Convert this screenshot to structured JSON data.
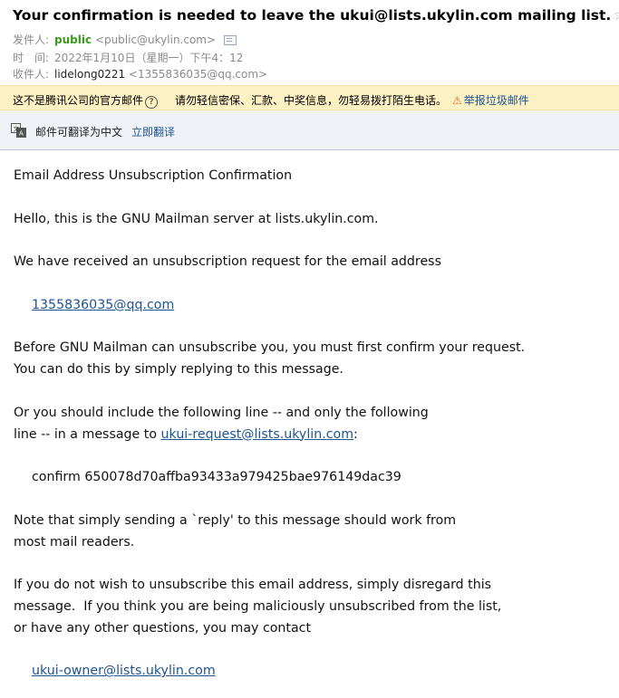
{
  "header": {
    "subject": "Your confirmation is needed to leave the ukui@lists.ukylin.com mailing list.",
    "star": "☆",
    "from_label": "发件人:",
    "from_name": "public",
    "from_address": "<public@ukylin.com>",
    "time_label": "时　间:",
    "time_value": "2022年1月10日（星期一）下午4：12",
    "to_label": "收件人:",
    "to_name": "lidelong0221",
    "to_address": "<1355836035@qq.com>"
  },
  "warning": {
    "text1": "这不是腾讯公司的官方邮件",
    "qmark": "?",
    "text2": "请勿轻信密保、汇款、中奖信息，勿轻易拨打陌生电话。",
    "report_label": "举报垃圾邮件"
  },
  "translate": {
    "text": "邮件可翻译为中文",
    "link": "立即翻译"
  },
  "body": {
    "l1": "Email Address Unsubscription Confirmation",
    "l2": "Hello, this is the GNU Mailman server at lists.ukylin.com.",
    "l3": "We have received an unsubscription request for the email address",
    "email_link": "1355836035@qq.com",
    "l5a": "Before GNU Mailman can unsubscribe you, you must first confirm your request.",
    "l5b": "You can do this by simply replying to this message.",
    "l6a": "Or you should include the following line -- and only the following",
    "l6b_prefix": "line -- in a message to ",
    "request_link": "ukui-request@lists.ukylin.com",
    "l6b_suffix": ":",
    "confirm_line": "confirm 650078d70affba93433a979425bae976149dac39",
    "l8a": "Note that simply sending a `reply' to this message should work from",
    "l8b": "most mail readers.",
    "l9a": "If you do not wish to unsubscribe this email address, simply disregard this",
    "l9b": "message.  If you think you are being maliciously unsubscribed from the list,",
    "l9c": "or have any other questions, you may contact",
    "owner_link": "ukui-owner@lists.ukylin.com"
  }
}
